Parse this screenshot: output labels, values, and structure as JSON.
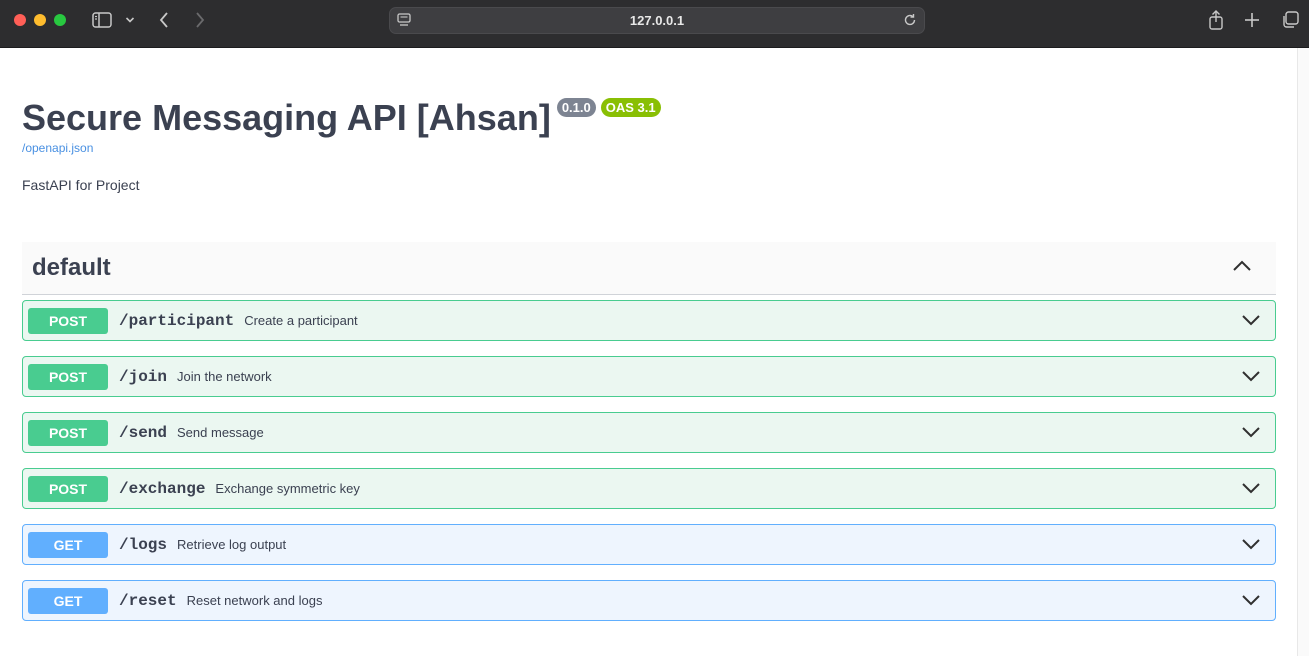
{
  "browser": {
    "url": "127.0.0.1",
    "icons": [
      "sidebar-icon",
      "chevron-down-icon",
      "back-icon",
      "forward-icon",
      "site-settings-icon",
      "reload-icon",
      "share-icon",
      "new-tab-icon",
      "tab-overview-icon"
    ]
  },
  "api": {
    "title": "Secure Messaging API [Ahsan]",
    "version": "0.1.0",
    "oas": "OAS 3.1",
    "spec_link": "/openapi.json",
    "description": "FastAPI for Project"
  },
  "tag": {
    "name": "default"
  },
  "operations": [
    {
      "method": "POST",
      "path": "/participant",
      "summary": "Create a participant"
    },
    {
      "method": "POST",
      "path": "/join",
      "summary": "Join the network"
    },
    {
      "method": "POST",
      "path": "/send",
      "summary": "Send message"
    },
    {
      "method": "POST",
      "path": "/exchange",
      "summary": "Exchange symmetric key"
    },
    {
      "method": "GET",
      "path": "/logs",
      "summary": "Retrieve log output"
    },
    {
      "method": "GET",
      "path": "/reset",
      "summary": "Reset network and logs"
    }
  ],
  "colors": {
    "post": "#49cc90",
    "get": "#61affe",
    "title": "#3b4151",
    "badge_version": "#7d8492",
    "badge_oas": "#89bf04",
    "link": "#4990e2"
  }
}
